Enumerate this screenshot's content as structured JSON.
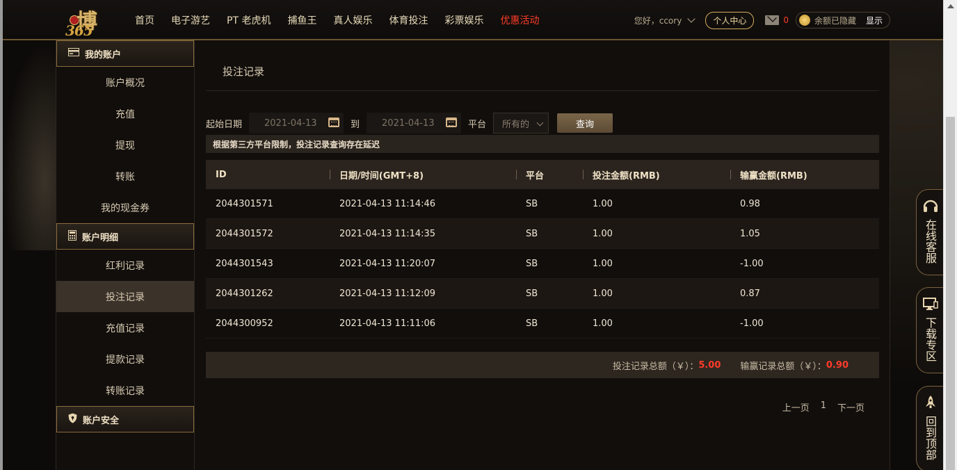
{
  "header": {
    "logo_text": "博",
    "logo_number": "365",
    "nav": [
      {
        "label": "首页",
        "hot": false
      },
      {
        "label": "电子游艺",
        "hot": false
      },
      {
        "label": "PT 老虎机",
        "hot": false
      },
      {
        "label": "捕鱼王",
        "hot": false
      },
      {
        "label": "真人娱乐",
        "hot": false
      },
      {
        "label": "体育投注",
        "hot": false
      },
      {
        "label": "彩票娱乐",
        "hot": false
      },
      {
        "label": "优惠活动",
        "hot": true
      }
    ],
    "greeting": "您好，ccory",
    "personal_center": "个人中心",
    "mail_count": "0",
    "balance_text": "余额已隐藏",
    "show_label": "显示"
  },
  "sidebar": {
    "sections": [
      {
        "title": "我的账户",
        "icon": "card-icon",
        "items": [
          {
            "label": "账户概况",
            "active": false
          },
          {
            "label": "充值",
            "active": false
          },
          {
            "label": "提现",
            "active": false
          },
          {
            "label": "转账",
            "active": false
          },
          {
            "label": "我的现金券",
            "active": false
          }
        ]
      },
      {
        "title": "账户明细",
        "icon": "calculator-icon",
        "items": [
          {
            "label": "红利记录",
            "active": false
          },
          {
            "label": "投注记录",
            "active": true
          },
          {
            "label": "充值记录",
            "active": false
          },
          {
            "label": "提款记录",
            "active": false
          },
          {
            "label": "转账记录",
            "active": false
          }
        ]
      },
      {
        "title": "账户安全",
        "icon": "shield-icon",
        "items": []
      }
    ]
  },
  "main": {
    "title": "投注记录",
    "filters": {
      "start_label": "起始日期",
      "start_date": "2021-04-13",
      "to_label": "到",
      "end_date": "2021-04-13",
      "platform_label": "平台",
      "platform_value": "所有的",
      "query_label": "查询"
    },
    "notice": "根据第三方平台限制，投注记录查询存在延迟",
    "table": {
      "headers": [
        "ID",
        "日期/时间(GMT+8)",
        "平台",
        "投注金额(RMB)",
        "输赢金额(RMB)"
      ],
      "rows": [
        [
          "2044301571",
          "2021-04-13 11:14:46",
          "SB",
          "1.00",
          "0.98"
        ],
        [
          "2044301572",
          "2021-04-13 11:14:35",
          "SB",
          "1.00",
          "1.05"
        ],
        [
          "2044301543",
          "2021-04-13 11:20:07",
          "SB",
          "1.00",
          "-1.00"
        ],
        [
          "2044301262",
          "2021-04-13 11:12:09",
          "SB",
          "1.00",
          "0.87"
        ],
        [
          "2044300952",
          "2021-04-13 11:11:06",
          "SB",
          "1.00",
          "-1.00"
        ]
      ]
    },
    "totals": {
      "bet_label": "投注记录总额（￥）：",
      "bet_value": "5.00",
      "win_label": "输赢记录总额（￥）：",
      "win_value": "0.90"
    },
    "pager": {
      "prev": "上一页",
      "page": "1",
      "next": "下一页"
    }
  },
  "float_buttons": [
    {
      "label": "在线客服",
      "icon": "headset-icon"
    },
    {
      "label": "下载专区",
      "icon": "monitor-icon"
    },
    {
      "label": "回到顶部",
      "icon": "rocket-icon"
    }
  ],
  "colors": {
    "accent": "#d4ad5e",
    "hot": "#ff3b2a",
    "background": "#110e0c"
  }
}
